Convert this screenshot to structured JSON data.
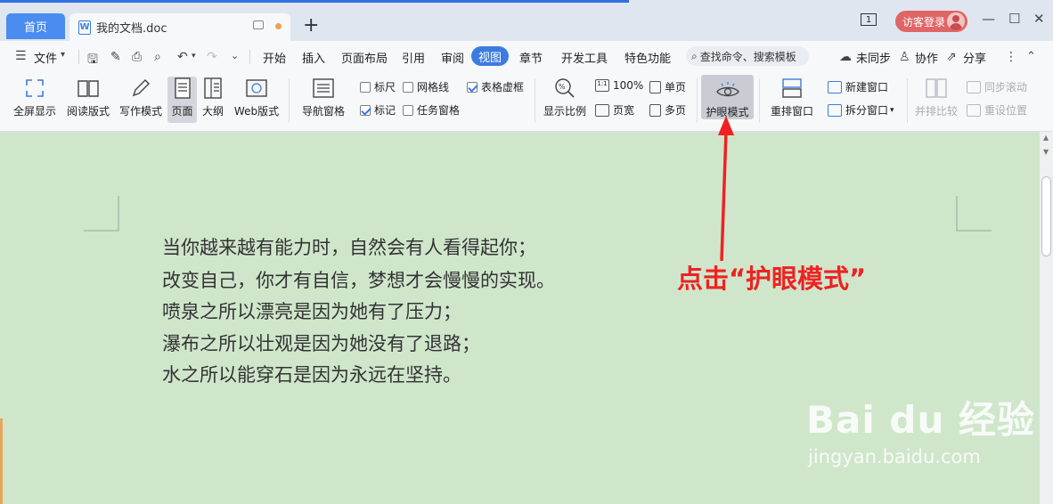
{
  "titlebar": {
    "home_tab": "首页",
    "doc_tab": "我的文档.doc",
    "doc_icon_letter": "W",
    "new_tab": "+",
    "page_count": "1",
    "guest_login": "访客登录",
    "minimize": "—",
    "maximize": "☐",
    "close": "✕"
  },
  "menubar": {
    "file": "文件",
    "items": [
      "开始",
      "插入",
      "页面布局",
      "引用",
      "审阅",
      "视图",
      "章节",
      "开发工具",
      "特色功能"
    ],
    "active": "视图",
    "search_placeholder": "查找命令、搜索模板",
    "sync": "未同步",
    "collab": "协作",
    "share": "分享"
  },
  "ribbon": {
    "fullscreen": "全屏显示",
    "read_mode": "阅读版式",
    "write_mode": "写作模式",
    "page": "页面",
    "outline": "大纲",
    "web": "Web版式",
    "nav_pane": "导航窗格",
    "ruler": "标尺",
    "gridlines": "网格线",
    "table_gridlines": "表格虚框",
    "marks": "标记",
    "task_pane": "任务窗格",
    "zoom": "显示比例",
    "zoom_100": "100%",
    "page_width": "页宽",
    "single_page": "单页",
    "multi_page": "多页",
    "eye_mode": "护眼模式",
    "rearrange": "重排窗口",
    "new_window": "新建窗口",
    "split_window": "拆分窗口",
    "compare": "并排比较",
    "sync_scroll": "同步滚动",
    "reset_position": "重设位置",
    "checked": {
      "ruler": false,
      "gridlines": false,
      "table_gridlines": true,
      "marks": true,
      "task_pane": false
    }
  },
  "document": {
    "lines": [
      "当你越来越有能力时，自然会有人看得起你；",
      "改变自己，你才有自信，梦想才会慢慢的实现。",
      "喷泉之所以漂亮是因为她有了压力；",
      "瀑布之所以壮观是因为她没有了退路；",
      "水之所以能穿石是因为永远在坚持。"
    ],
    "background_color": "#cfe6cb"
  },
  "annotation": {
    "text": "点击“护眼模式”",
    "color": "#ee2222"
  },
  "watermark": {
    "logo": "Bai du 经验",
    "url": "jingyan.baidu.com"
  },
  "colors": {
    "accent": "#3c7be0",
    "home_tab": "#4b8cf0",
    "guest_button": "#e06666"
  }
}
